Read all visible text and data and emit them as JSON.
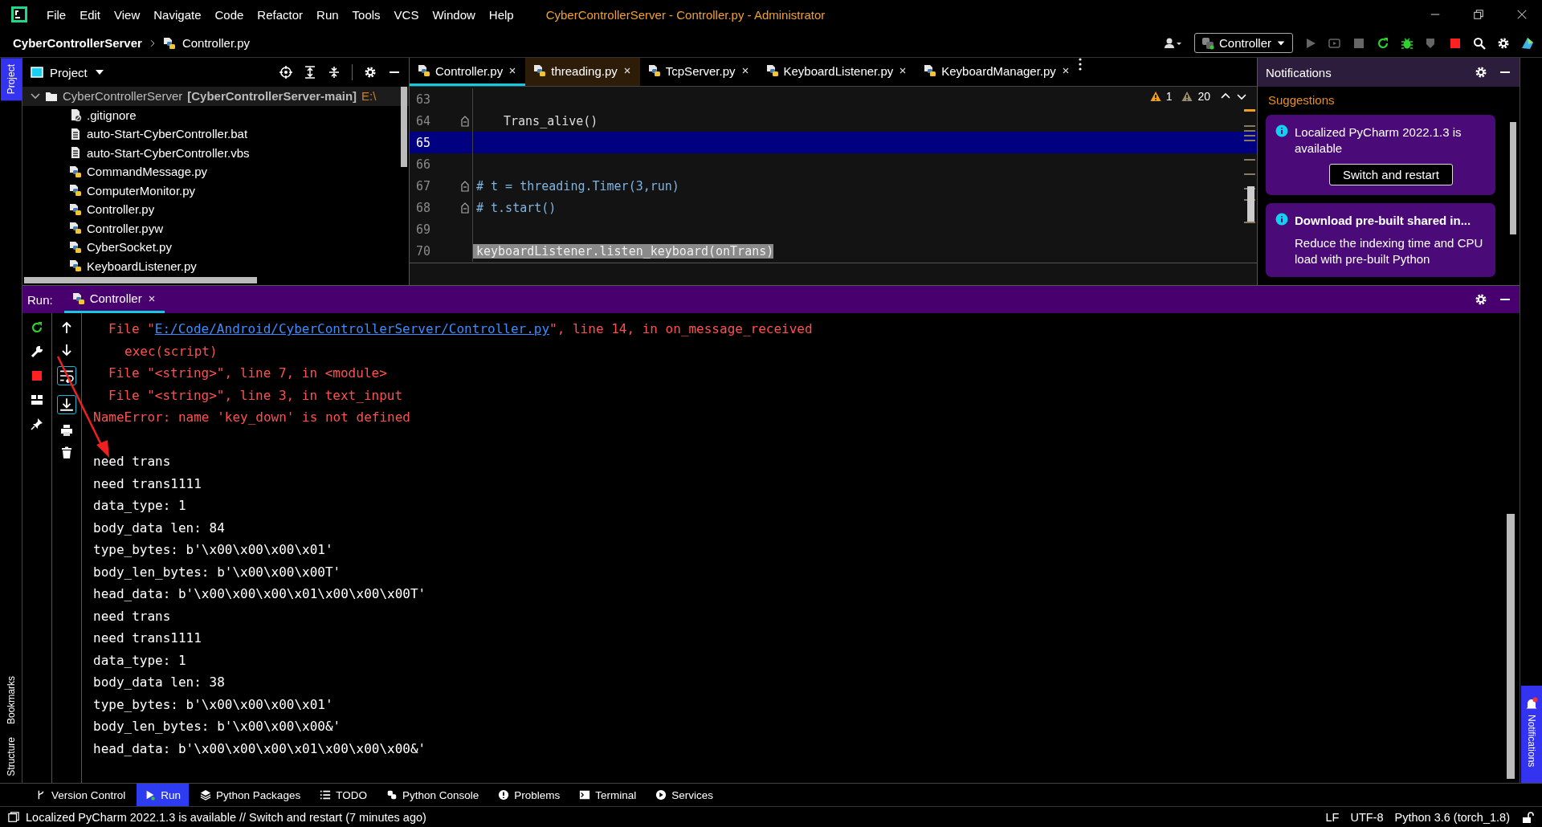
{
  "menu": [
    "File",
    "Edit",
    "View",
    "Navigate",
    "Code",
    "Refactor",
    "Run",
    "Tools",
    "VCS",
    "Window",
    "Help"
  ],
  "window_title": "CyberControllerServer - Controller.py - Administrator",
  "breadcrumb": [
    "CyberControllerServer",
    "Controller.py"
  ],
  "run_config": "Controller",
  "left_strip": [
    {
      "label": "Project",
      "selected": true
    },
    {
      "label": "Bookmarks",
      "selected": false
    },
    {
      "label": "Structure",
      "selected": false
    }
  ],
  "project": {
    "title": "Project",
    "root": {
      "name": "CyberControllerServer",
      "module": "[CyberControllerServer-main]",
      "path": "E:\\",
      "expanded": true,
      "children": [
        {
          "name": ".gitignore",
          "kind": "ignored"
        },
        {
          "name": "auto-Start-CyberController.bat",
          "kind": "text"
        },
        {
          "name": "auto-Start-CyberController.vbs",
          "kind": "text"
        },
        {
          "name": "CommandMessage.py",
          "kind": "python"
        },
        {
          "name": "ComputerMonitor.py",
          "kind": "python"
        },
        {
          "name": "Controller.py",
          "kind": "python"
        },
        {
          "name": "Controller.pyw",
          "kind": "python"
        },
        {
          "name": "CyberSocket.py",
          "kind": "python"
        },
        {
          "name": "KeyboardListener.py",
          "kind": "python"
        }
      ]
    }
  },
  "editor_tabs": [
    {
      "label": "Controller.py",
      "selected": true,
      "external": false
    },
    {
      "label": "threading.py",
      "selected": false,
      "external": true
    },
    {
      "label": "TcpServer.py",
      "selected": false,
      "external": false
    },
    {
      "label": "KeyboardListener.py",
      "selected": false,
      "external": false
    },
    {
      "label": "KeyboardManager.py",
      "selected": false,
      "external": false
    }
  ],
  "editor": {
    "warnings": "1",
    "weak_warnings": "20",
    "lines": [
      {
        "number": "63",
        "current": false,
        "fold": false
      },
      {
        "number": "64",
        "code": "Trans_alive()",
        "kind": "body",
        "current": false,
        "fold": true
      },
      {
        "number": "65",
        "current": true,
        "fold": false
      },
      {
        "number": "66",
        "current": false,
        "fold": false
      },
      {
        "number": "67",
        "code": "# t = threading.Timer(3,run)",
        "kind": "comment",
        "current": false,
        "fold": true
      },
      {
        "number": "68",
        "code": "# t.start()",
        "kind": "comment",
        "current": false,
        "fold": true
      },
      {
        "number": "69",
        "current": false,
        "fold": false
      },
      {
        "number": "70",
        "code": "keyboardListener.listen_keyboard(onTrans)",
        "kind": "covered",
        "current": false,
        "fold": false
      }
    ]
  },
  "notifications": {
    "title": "Notifications",
    "section": "Suggestions",
    "items": [
      {
        "title": "Localized PyCharm 2022.1.3 is available",
        "bold": false,
        "button": "Switch and restart"
      },
      {
        "title": "Download pre-built shared in...",
        "bold": true,
        "body": "Reduce the indexing time and CPU load with pre-built Python"
      }
    ]
  },
  "run": {
    "label": "Run:",
    "tabs": [
      {
        "label": "Controller",
        "selected": true
      }
    ],
    "output": [
      {
        "kind": "trace-link",
        "before": "File \"",
        "link": "E:/Code/Android/CyberControllerServer/Controller.py",
        "after": "\", line 14, in on_message_received"
      },
      {
        "kind": "trace-code",
        "text": "exec(script)"
      },
      {
        "kind": "trace",
        "text": "File \"<string>\", line 7, in <module>"
      },
      {
        "kind": "trace",
        "text": "File \"<string>\", line 3, in text_input"
      },
      {
        "kind": "error",
        "text": "NameError: name 'key_down' is not defined"
      },
      {
        "kind": "blank"
      },
      {
        "kind": "out",
        "text": "need trans"
      },
      {
        "kind": "out",
        "text": "need trans1111"
      },
      {
        "kind": "out",
        "text": "data_type: 1"
      },
      {
        "kind": "out",
        "text": "body_data len: 84"
      },
      {
        "kind": "out",
        "text": "type_bytes: b'\\x00\\x00\\x00\\x01'"
      },
      {
        "kind": "out",
        "text": "body_len_bytes: b'\\x00\\x00\\x00T'"
      },
      {
        "kind": "out",
        "text": "head_data: b'\\x00\\x00\\x00\\x01\\x00\\x00\\x00T'"
      },
      {
        "kind": "out",
        "text": "need trans"
      },
      {
        "kind": "out",
        "text": "need trans1111"
      },
      {
        "kind": "out",
        "text": "data_type: 1"
      },
      {
        "kind": "out",
        "text": "body_data len: 38"
      },
      {
        "kind": "out",
        "text": "type_bytes: b'\\x00\\x00\\x00\\x01'"
      },
      {
        "kind": "out",
        "text": "body_len_bytes: b'\\x00\\x00\\x00&'"
      },
      {
        "kind": "out",
        "text": "head_data: b'\\x00\\x00\\x00\\x01\\x00\\x00\\x00&'"
      }
    ]
  },
  "right_strip": [
    {
      "label": "Notifications",
      "selected": true,
      "badge": true
    }
  ],
  "tool_tabs": [
    {
      "label": "Version Control",
      "kind": "vcs",
      "selected": false
    },
    {
      "label": "Run",
      "kind": "run",
      "selected": true
    },
    {
      "label": "Python Packages",
      "kind": "packages",
      "selected": false
    },
    {
      "label": "TODO",
      "kind": "todo",
      "selected": false
    },
    {
      "label": "Python Console",
      "kind": "console",
      "selected": false
    },
    {
      "label": "Problems",
      "kind": "problems",
      "selected": false
    },
    {
      "label": "Terminal",
      "kind": "terminal",
      "selected": false
    },
    {
      "label": "Services",
      "kind": "services",
      "selected": false
    }
  ],
  "status": {
    "message": "Localized PyCharm 2022.1.3 is available // Switch and restart (7 minutes ago)",
    "items": [
      "LF",
      "UTF-8",
      "Python 3.6 (torch_1.8)"
    ]
  }
}
